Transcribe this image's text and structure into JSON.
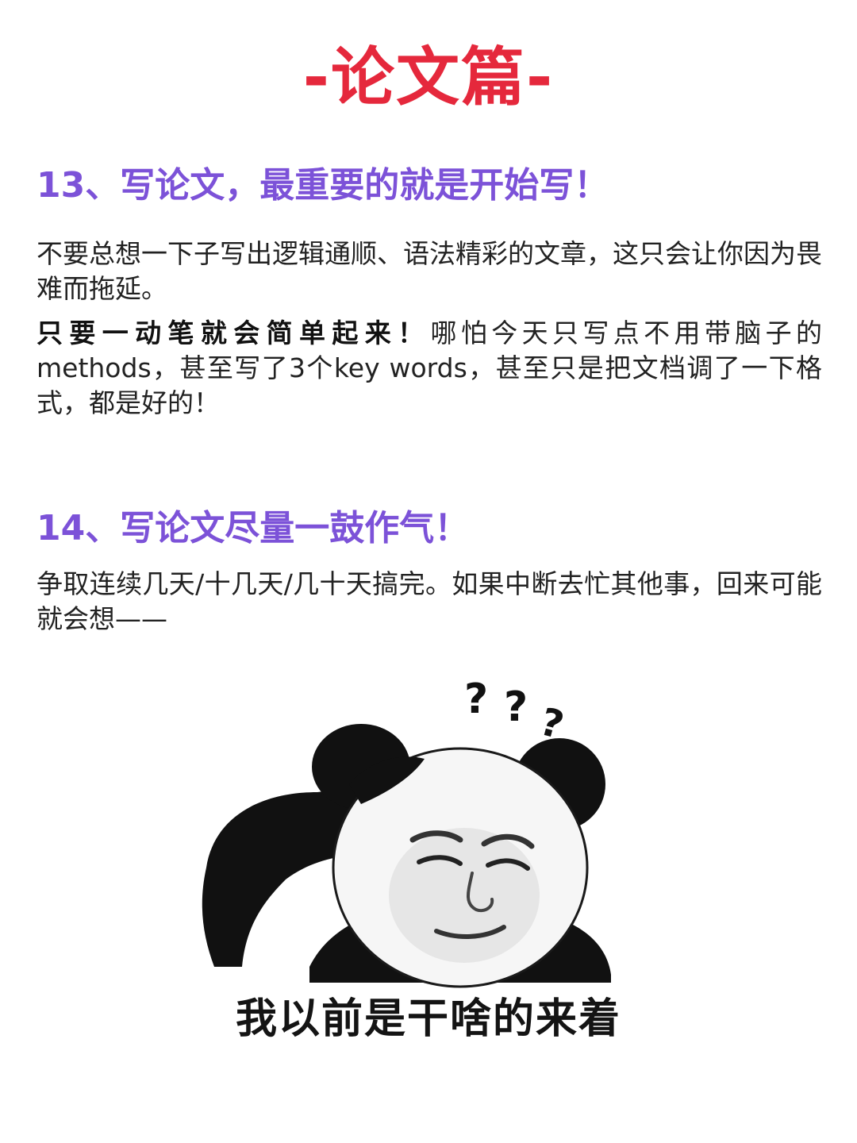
{
  "title": "-论文篇-",
  "section13": {
    "heading": "13、写论文，最重要的就是开始写！",
    "para1": "不要总想一下子写出逻辑通顺、语法精彩的文章，这只会让你因为畏难而拖延。",
    "para2_bold": "只要一动笔就会简单起来！",
    "para2_rest": "哪怕今天只写点不用带脑子的methods，甚至写了3个key words，甚至只是把文档调了一下格式，都是好的！"
  },
  "section14": {
    "heading": "14、写论文尽量一鼓作气！",
    "para": "争取连续几天/十几天/几十天搞完。如果中断去忙其他事，回来可能就会想——"
  },
  "meme": {
    "question_marks": "? ? ?",
    "caption": "我以前是干啥的来着"
  },
  "colors": {
    "title": "#e5283c",
    "heading": "#7c52d8",
    "body_text": "#222222"
  }
}
